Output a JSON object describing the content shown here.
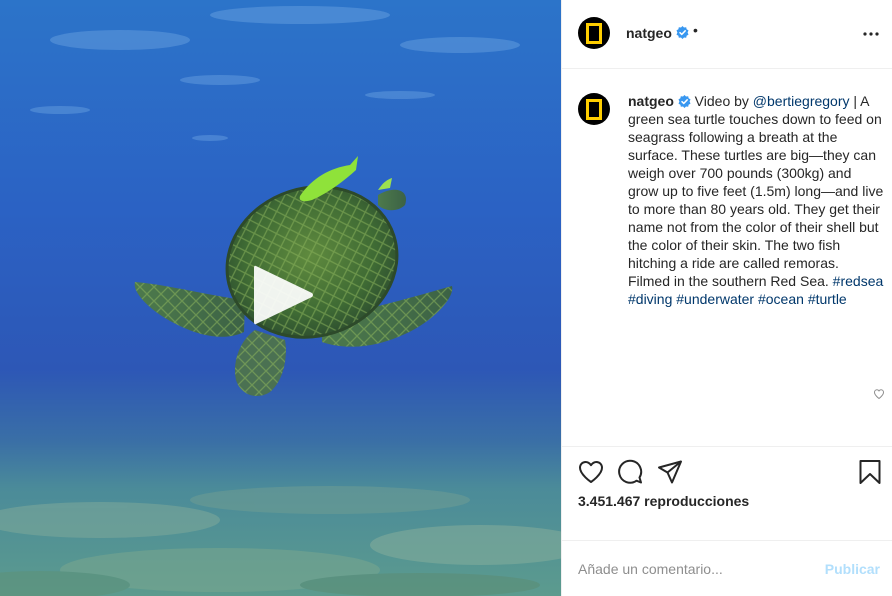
{
  "post": {
    "username": "natgeo",
    "header_separator": "•",
    "caption": {
      "intro": "Video by ",
      "mention": "@bertiegregory",
      "text": " | A green sea turtle touches down to feed on seagrass following a breath at the surface. These turtles are big—they can weigh over 700 pounds (300kg) and grow up to five feet (1.5m) long—and live to more than 80 years old. They get their name not from the color of their shell but the color of their skin. The two fish hitching a ride are called remoras. Filmed in the southern Red Sea. ",
      "hashtags": [
        "#redsea",
        "#diving",
        "#underwater",
        "#ocean",
        "#turtle"
      ]
    },
    "views": "3.451.467 reproducciones",
    "comment": {
      "placeholder": "Añade un comentario...",
      "publish_label": "Publicar"
    }
  },
  "icons": {
    "verified": "verified-badge-icon",
    "more": "more-options-icon",
    "like": "heart-icon",
    "comment": "comment-icon",
    "share": "share-icon",
    "save": "bookmark-icon",
    "play": "play-icon"
  },
  "colors": {
    "verified_blue": "#3897f0",
    "link": "#00376b",
    "publish_disabled": "#b2dffc",
    "natgeo_yellow": "#ffce00",
    "border": "#efefef"
  }
}
